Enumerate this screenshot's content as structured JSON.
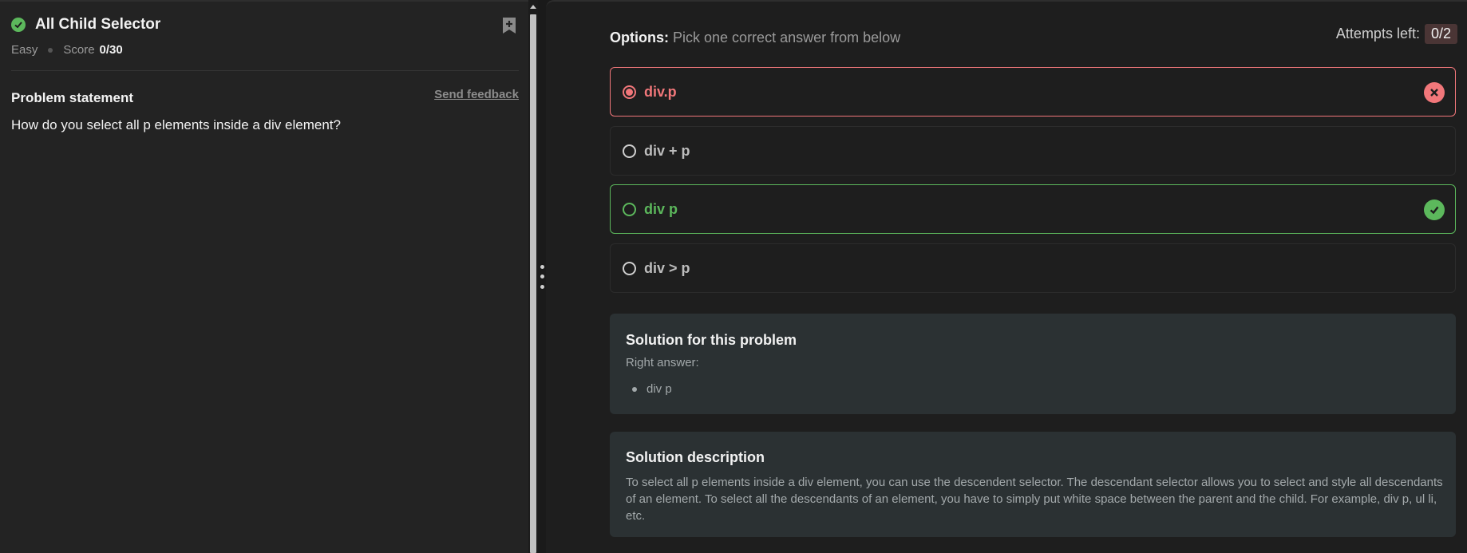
{
  "problem": {
    "title": "All Child Selector",
    "difficulty": "Easy",
    "score_label": "Score",
    "score_value": "0/30",
    "statement_heading": "Problem statement",
    "feedback_link": "Send feedback",
    "question": "How do you select all p elements inside a div element?"
  },
  "options_panel": {
    "heading_bold": "Options:",
    "heading_hint": "Pick one correct answer from below",
    "attempts_label": "Attempts left:",
    "attempts_value": "0/2",
    "options": [
      {
        "label": "div.p",
        "state": "selected-wrong"
      },
      {
        "label": "div + p",
        "state": "neutral"
      },
      {
        "label": "div p",
        "state": "correct"
      },
      {
        "label": "div > p",
        "state": "neutral"
      }
    ]
  },
  "solution": {
    "title": "Solution for this problem",
    "right_answer_label": "Right answer:",
    "answers": [
      "div p"
    ]
  },
  "description": {
    "title": "Solution description",
    "text": "To select all p elements inside a div element, you can use the descendent selector. The descendant selector allows you to select and style all descendants of an element. To select all the descendants of an element, you have to simply put white space between the parent and the child. For example, div p, ul li, etc."
  },
  "colors": {
    "success": "#5cb85c",
    "error": "#f1777a",
    "card_bg": "#2b3133"
  }
}
